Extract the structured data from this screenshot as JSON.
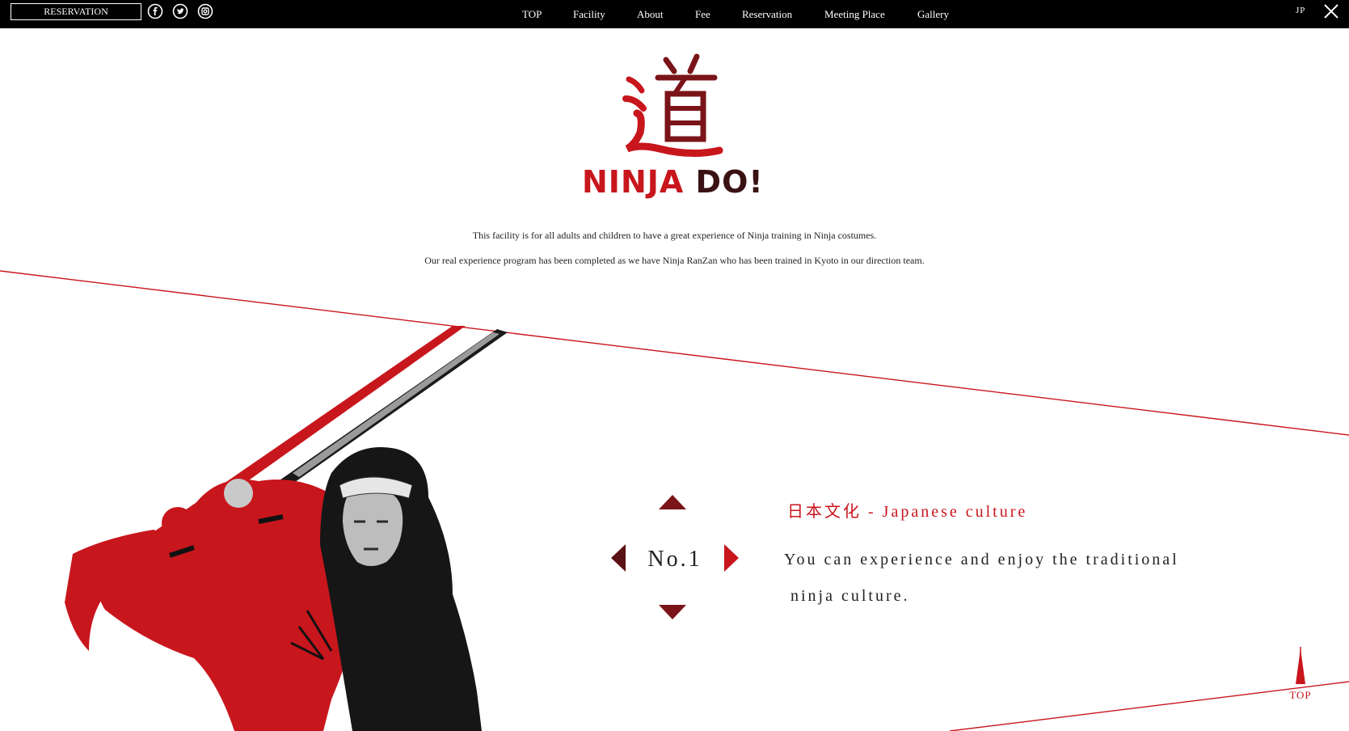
{
  "header": {
    "reservation_label": "RESERVATION",
    "nav": [
      {
        "label": "TOP"
      },
      {
        "label": "Facility"
      },
      {
        "label": "About"
      },
      {
        "label": "Fee"
      },
      {
        "label": "Reservation"
      },
      {
        "label": "Meeting Place"
      },
      {
        "label": "Gallery"
      }
    ],
    "lang_label": "JP",
    "social_icons": [
      "facebook-icon",
      "twitter-icon",
      "instagram-icon"
    ]
  },
  "logo": {
    "kanji": "道",
    "word1": "NINJA",
    "word2": "DO!"
  },
  "intro": {
    "line1": "This facility is for all adults and children to have a great experience of Ninja training in Ninja costumes.",
    "line2": "Our real experience program has been completed as we have Ninja RanZan who has been trained in Kyoto in our direction team."
  },
  "slider": {
    "number_label": "No.1",
    "title": "日本文化 - Japanese culture",
    "body_line1": "You can experience and enjoy the traditional",
    "body_line2": " ninja culture."
  },
  "top_button_label": "TOP",
  "colors": {
    "accent": "#c8161d",
    "dark_red": "#7a1418",
    "bar": "#000000",
    "logo_dark": "#3a1214"
  }
}
